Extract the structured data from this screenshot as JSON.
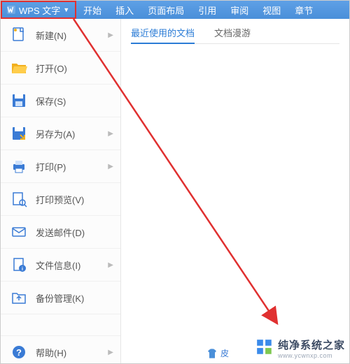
{
  "app": {
    "title": "WPS 文字"
  },
  "ribbon_tabs": [
    {
      "label": "开始"
    },
    {
      "label": "插入"
    },
    {
      "label": "页面布局"
    },
    {
      "label": "引用"
    },
    {
      "label": "审阅"
    },
    {
      "label": "视图"
    },
    {
      "label": "章节"
    }
  ],
  "sidebar": {
    "items": [
      {
        "icon": "file-new-icon",
        "label": "新建(N)",
        "arrow": true
      },
      {
        "icon": "folder-open-icon",
        "label": "打开(O)",
        "arrow": false
      },
      {
        "icon": "save-icon",
        "label": "保存(S)",
        "arrow": false
      },
      {
        "icon": "save-as-icon",
        "label": "另存为(A)",
        "arrow": true
      },
      {
        "icon": "print-icon",
        "label": "打印(P)",
        "arrow": true
      },
      {
        "icon": "print-preview-icon",
        "label": "打印预览(V)",
        "arrow": false
      },
      {
        "icon": "mail-icon",
        "label": "发送邮件(D)",
        "arrow": false
      },
      {
        "icon": "file-info-icon",
        "label": "文件信息(I)",
        "arrow": true
      },
      {
        "icon": "backup-icon",
        "label": "备份管理(K)",
        "arrow": false
      },
      {
        "icon": "help-icon",
        "label": "帮助(H)",
        "arrow": true
      }
    ]
  },
  "content_tabs": [
    "最近使用的文档",
    "文档漫游"
  ],
  "skin_label": "皮",
  "watermark": {
    "name": "纯净系统之家",
    "url": "www.ycwnxp.com"
  }
}
